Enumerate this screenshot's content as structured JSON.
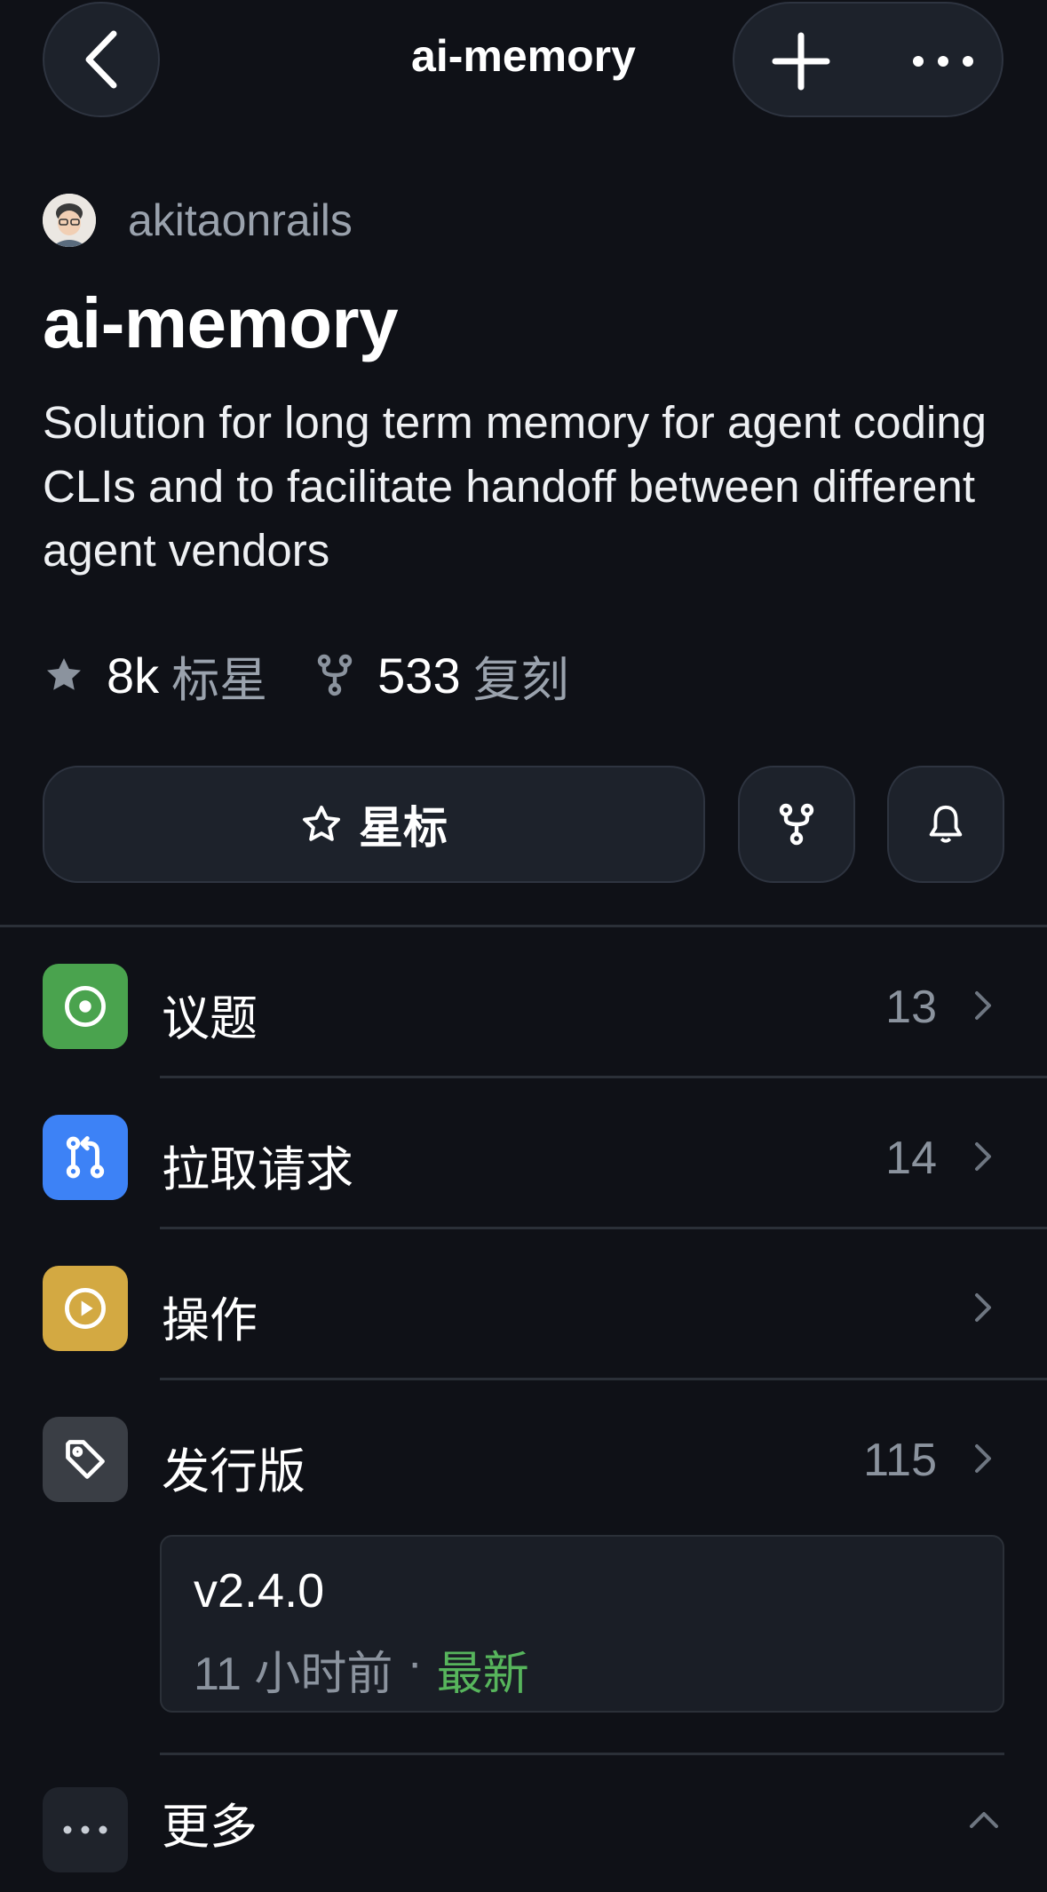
{
  "nav": {
    "title": "ai-memory"
  },
  "repo": {
    "owner": "akitaonrails",
    "name": "ai-memory",
    "description": "Solution for long term memory for agent coding CLIs and to facilitate handoff between different agent vendors",
    "stars": "8k",
    "stars_label": "标星",
    "forks": "533",
    "forks_label": "复刻"
  },
  "actions": {
    "star_label": "星标"
  },
  "rows": [
    {
      "label": "议题",
      "count": "13",
      "color": "#4aa34e",
      "icon": "issue-icon"
    },
    {
      "label": "拉取请求",
      "count": "14",
      "color": "#3d82f6",
      "icon": "pull-request-icon"
    },
    {
      "label": "操作",
      "count": "",
      "color": "#d3a942",
      "icon": "play-icon"
    },
    {
      "label": "发行版",
      "count": "115",
      "color": "#3a3e45",
      "icon": "tag-icon"
    }
  ],
  "release": {
    "version": "v2.4.0",
    "time": "11 小时前",
    "dot": "·",
    "badge": "最新"
  },
  "more": {
    "label": "更多"
  },
  "colors": {
    "background": "#0f1117",
    "surface": "#1d222b",
    "muted_text": "#8b939e",
    "latest_green": "#57b55c"
  }
}
